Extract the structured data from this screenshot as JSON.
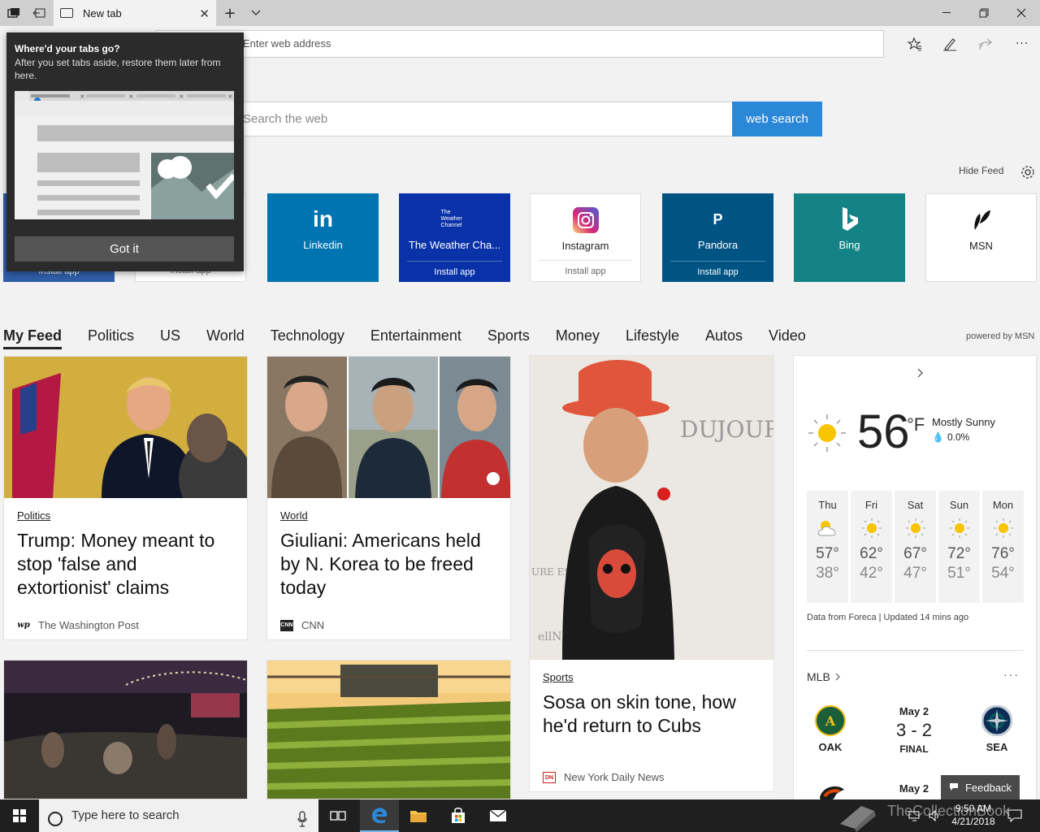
{
  "browser": {
    "tab_title": "New tab",
    "address_placeholder": "Enter web address",
    "window_controls": [
      "minimize",
      "restore",
      "close"
    ]
  },
  "popup": {
    "title": "Where'd your tabs go?",
    "description": "After you set tabs aside, restore them later from here.",
    "button": "Got it"
  },
  "search": {
    "placeholder": "Search the web",
    "button": "web search"
  },
  "hide_feed": "Hide Feed",
  "top_sites": [
    {
      "label": "Linkedin",
      "icon": "linkedin-icon",
      "color": "#0073b1",
      "install": ""
    },
    {
      "label": "The Weather Cha...",
      "icon": "weather-channel-icon",
      "color": "#0a32a8",
      "install": "Install app",
      "icon_text": "The Weather Channel"
    },
    {
      "label": "Instagram",
      "icon": "instagram-icon",
      "color": "#ffffff",
      "install": "Install app"
    },
    {
      "label": "Pandora",
      "icon": "pandora-icon",
      "color": "#005483",
      "install": "Install app",
      "icon_text": "P"
    },
    {
      "label": "Bing",
      "icon": "bing-icon",
      "color": "#138386",
      "install": ""
    },
    {
      "label": "MSN",
      "icon": "msn-icon",
      "color": "#ffffff",
      "install": ""
    }
  ],
  "hidden_tiles_install": "Install app",
  "feed_nav": [
    "My Feed",
    "Politics",
    "US",
    "World",
    "Technology",
    "Entertainment",
    "Sports",
    "Money",
    "Lifestyle",
    "Autos",
    "Video"
  ],
  "powered_by": "powered by MSN",
  "cards": [
    {
      "category": "Politics",
      "headline": "Trump: Money meant to stop 'false and extortionist' claims",
      "source": "The Washington Post",
      "source_icon": "wp"
    },
    {
      "category": "World",
      "headline": "Giuliani: Americans held by N. Korea to be freed today",
      "source": "CNN",
      "source_icon": "CNN"
    },
    {
      "category": "Sports",
      "headline": "Sosa on skin tone, how he'd return to Cubs",
      "source": "New York Daily News",
      "source_icon": "DN"
    }
  ],
  "weather": {
    "temp": "56",
    "unit": "°F",
    "condition": "Mostly Sunny",
    "precip": "0.0%",
    "forecast": [
      {
        "day": "Thu",
        "hi": "57°",
        "lo": "38°",
        "icon": "partly-cloudy-icon"
      },
      {
        "day": "Fri",
        "hi": "62°",
        "lo": "42°",
        "icon": "sun-icon"
      },
      {
        "day": "Sat",
        "hi": "67°",
        "lo": "47°",
        "icon": "sun-icon"
      },
      {
        "day": "Sun",
        "hi": "72°",
        "lo": "51°",
        "icon": "sun-icon"
      },
      {
        "day": "Mon",
        "hi": "76°",
        "lo": "54°",
        "icon": "sun-icon"
      }
    ],
    "data_note": "Data from Foreca | Updated 14 mins ago"
  },
  "mlb": {
    "title": "MLB",
    "game1": {
      "date": "May 2",
      "score": "3 - 2",
      "status": "FINAL",
      "away": "OAK",
      "home": "SEA"
    },
    "game2": {
      "date": "May 2"
    }
  },
  "feedback": "Feedback",
  "taskbar": {
    "search_placeholder": "Type here to search",
    "time": "9:50 AM",
    "date": "4/21/2018"
  },
  "watermark": "TheCollectionBook"
}
